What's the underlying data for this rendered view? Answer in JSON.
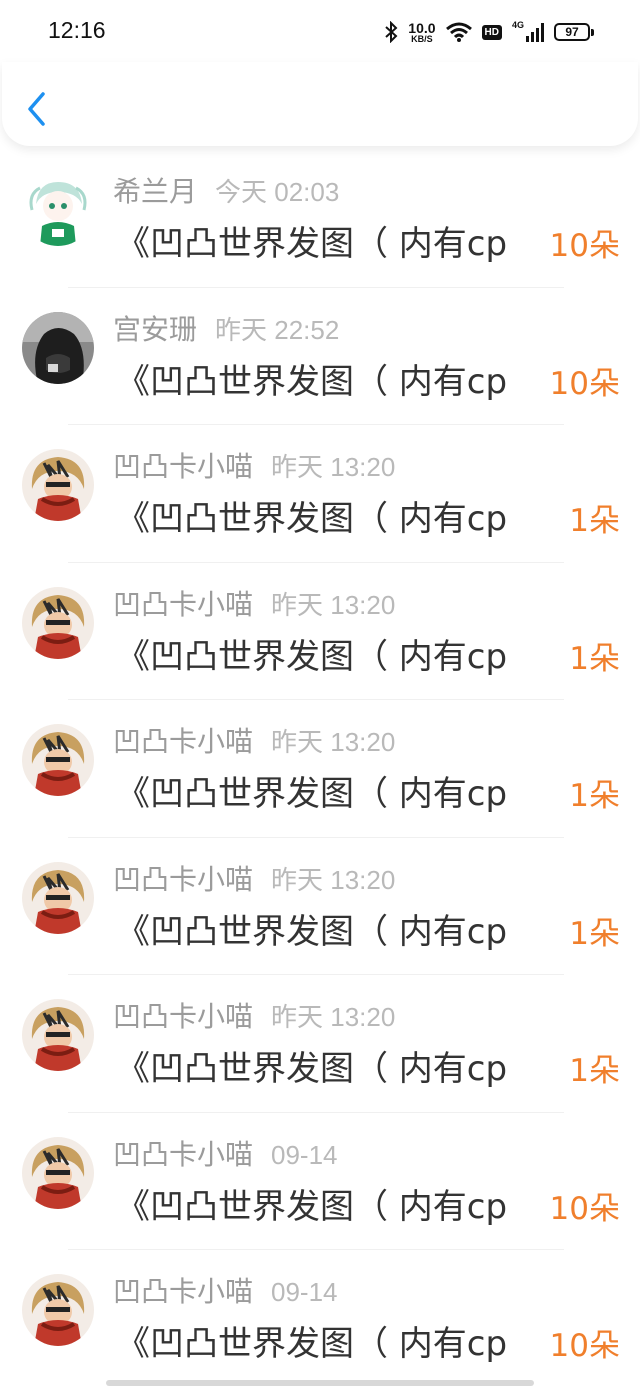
{
  "status_bar": {
    "time": "12:16",
    "net_speed": "10.0",
    "net_unit": "KB/S",
    "hd": "HD",
    "network": "4G",
    "battery": "97"
  },
  "colors": {
    "accent": "#1e90f0",
    "count": "#f07f2c",
    "name": "#9b9b9b",
    "time": "#b9b9b9"
  },
  "items": [
    {
      "name": "希兰月",
      "time": "今天 02:03",
      "message": "《凹凸世界发图（ 内有cp",
      "count": "10朵",
      "avatar": "anime-green-shirt"
    },
    {
      "name": "宫安珊",
      "time": "昨天 22:52",
      "message": "《凹凸世界发图（ 内有cp",
      "count": "10朵",
      "avatar": "dark-hair-photo"
    },
    {
      "name": "凹凸卡小喵",
      "time": "昨天 13:20",
      "message": "《凹凸世界发图（ 内有cp",
      "count": "1朵",
      "avatar": "anime-red-scarf"
    },
    {
      "name": "凹凸卡小喵",
      "time": "昨天 13:20",
      "message": "《凹凸世界发图（ 内有cp",
      "count": "1朵",
      "avatar": "anime-red-scarf"
    },
    {
      "name": "凹凸卡小喵",
      "time": "昨天 13:20",
      "message": "《凹凸世界发图（ 内有cp",
      "count": "1朵",
      "avatar": "anime-red-scarf"
    },
    {
      "name": "凹凸卡小喵",
      "time": "昨天 13:20",
      "message": "《凹凸世界发图（ 内有cp",
      "count": "1朵",
      "avatar": "anime-red-scarf"
    },
    {
      "name": "凹凸卡小喵",
      "time": "昨天 13:20",
      "message": "《凹凸世界发图（ 内有cp",
      "count": "1朵",
      "avatar": "anime-red-scarf"
    },
    {
      "name": "凹凸卡小喵",
      "time": "09-14",
      "message": "《凹凸世界发图（ 内有cp",
      "count": "10朵",
      "avatar": "anime-red-scarf"
    },
    {
      "name": "凹凸卡小喵",
      "time": "09-14",
      "message": "《凹凸世界发图（ 内有cp",
      "count": "10朵",
      "avatar": "anime-red-scarf"
    }
  ]
}
